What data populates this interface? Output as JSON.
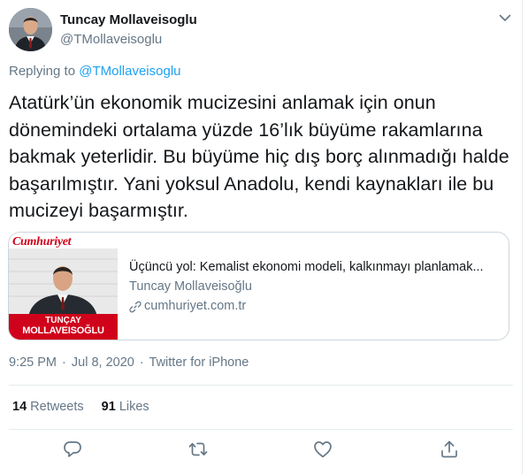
{
  "author": {
    "display_name": "Tuncay Mollaveisoglu",
    "handle": "@TMollaveisoglu"
  },
  "reply": {
    "prefix": "Replying to ",
    "to": "@TMollaveisoglu"
  },
  "tweet": {
    "text": "Atatürk’ün ekonomik mucizesini anlamak için onun dönemindeki ortalama yüzde 16’lık büyüme rakamlarına bakmak yeterlidir. Bu büyüme hiç dış borç alınmadığı halde başarılmıştır. Yani yoksul Anadolu, kendi kaynakları ile bu mucizeyi başarmıştır."
  },
  "card": {
    "thumb_brand": "Cumhuriyet",
    "thumb_name_line1": "TUNÇAY",
    "thumb_name_line2": "MOLLAVEISOĞLU",
    "title": "Üçüncü yol: Kemalist ekonomi modeli, kalkınmayı planlamak...",
    "author": "Tuncay Mollaveisoğlu",
    "domain": "cumhuriyet.com.tr"
  },
  "meta": {
    "time": "9:25 PM",
    "separator": "·",
    "date": "Jul 8, 2020",
    "source": "Twitter for iPhone"
  },
  "stats": {
    "retweets_count": "14",
    "retweets_label": "Retweets",
    "likes_count": "91",
    "likes_label": "Likes"
  },
  "icons": {
    "more": "chevron-down-icon",
    "reply": "reply-icon",
    "retweet": "retweet-icon",
    "like": "heart-icon",
    "share": "share-icon",
    "link": "link-icon"
  },
  "colors": {
    "accent": "#1da1f2",
    "secondary_text": "#657786",
    "primary_text": "#14171a",
    "border": "#e6ecf0",
    "brand_red": "#d0021b"
  }
}
